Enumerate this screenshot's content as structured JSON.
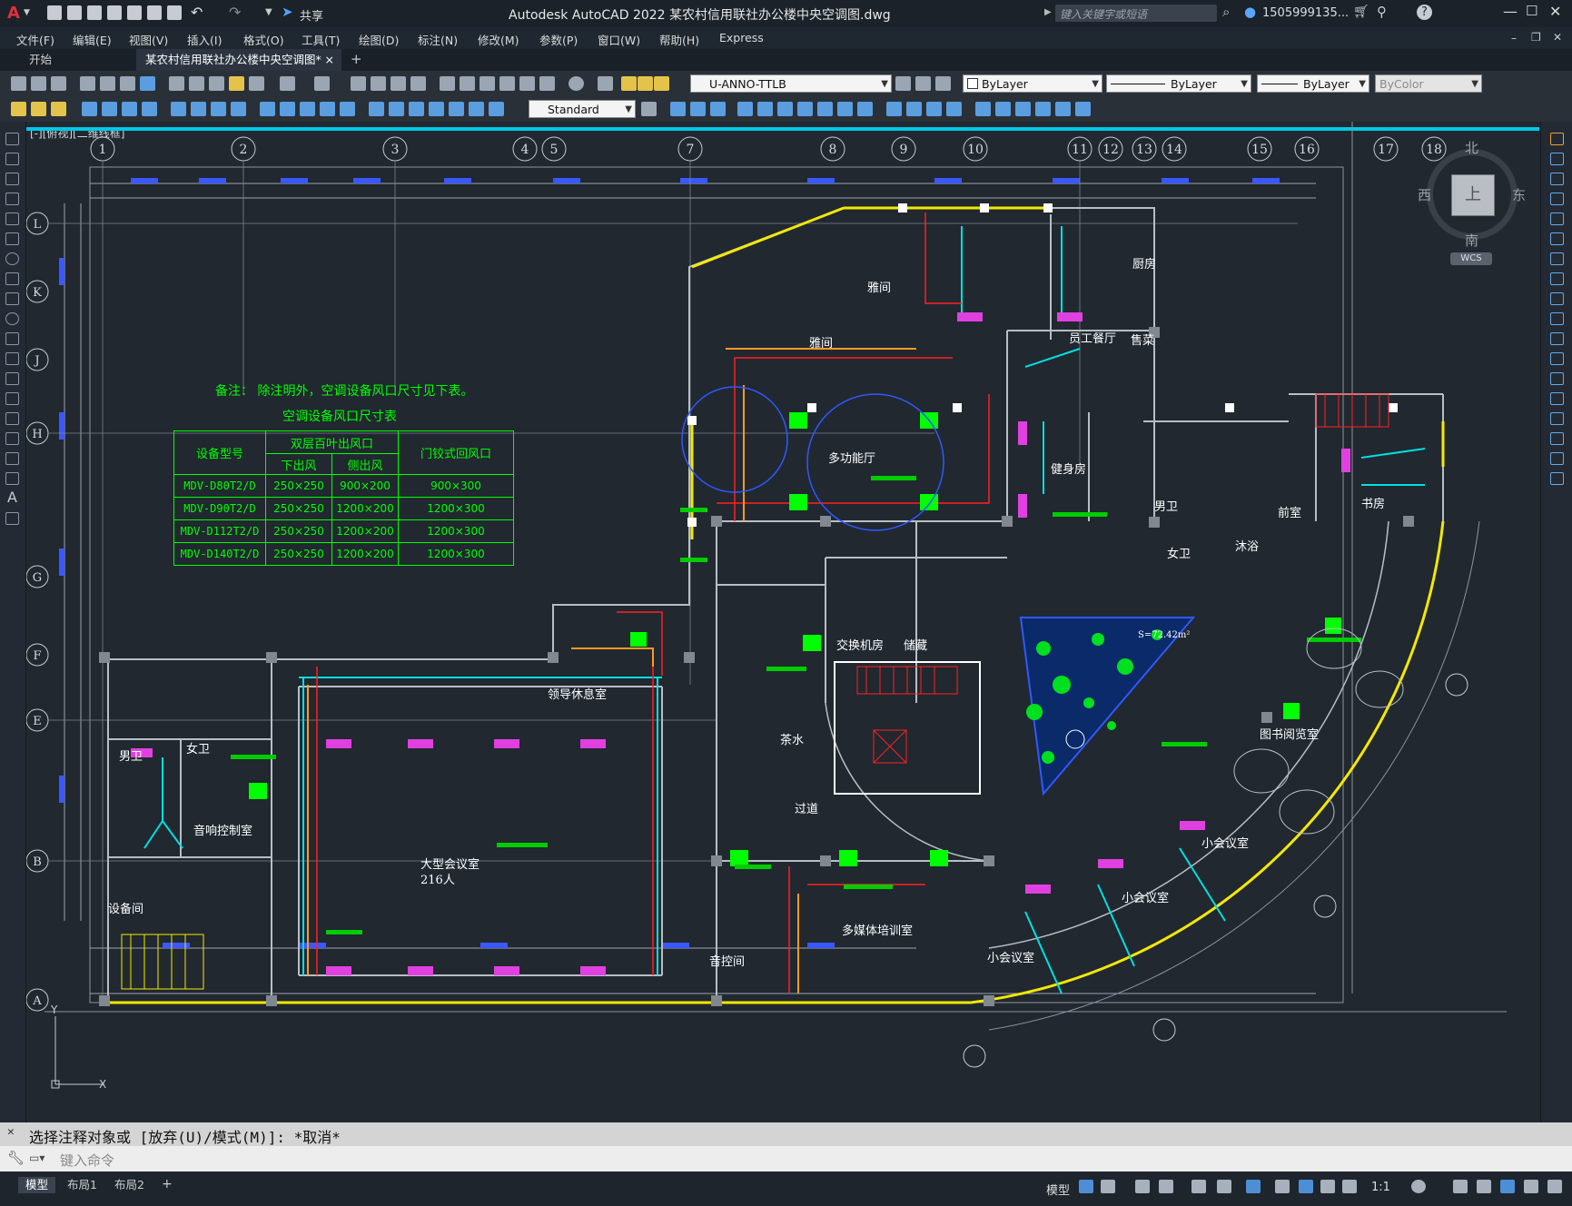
{
  "app": {
    "title": "Autodesk AutoCAD 2022    某农村信用联社办公楼中央空调图.dwg",
    "share_label": "共享",
    "search_placeholder": "键入关键字或短语",
    "user": "1505999135...",
    "logo_letter": "A"
  },
  "menu": [
    "文件(F)",
    "编辑(E)",
    "视图(V)",
    "插入(I)",
    "格式(O)",
    "工具(T)",
    "绘图(D)",
    "标注(N)",
    "修改(M)",
    "参数(P)",
    "窗口(W)",
    "帮助(H)",
    "Express"
  ],
  "tabs": {
    "start": "开始",
    "doc": "某农村信用联社办公楼中央空调图*",
    "close": "×",
    "add": "+"
  },
  "toolbar": {
    "layer_value": "U-ANNO-TTLB",
    "color_value": "ByLayer",
    "linetype_value": "ByLayer",
    "lineweight_value": "ByLayer",
    "plotstyle_value": "ByColor",
    "style_value": "Standard"
  },
  "viewport": {
    "label": "[-][俯视][二维线框]"
  },
  "viewcube": {
    "north": "北",
    "south": "南",
    "east": "东",
    "west": "西",
    "top": "上",
    "wcs": "WCS"
  },
  "drawing": {
    "note": "备注：  除注明外，空调设备风口尺寸见下表。",
    "table_title": "空调设备风口尺寸表",
    "table": {
      "h_model": "设备型号",
      "h_double": "双层百叶出风口",
      "h_down": "下出风",
      "h_side": "侧出风",
      "h_return": "门铰式回风口",
      "rows": [
        [
          "MDV-D80T2/D",
          "250×250",
          "900×200",
          "900×300"
        ],
        [
          "MDV-D90T2/D",
          "250×250",
          "1200×200",
          "1200×300"
        ],
        [
          "MDV-D112T2/D",
          "250×250",
          "1200×200",
          "1200×300"
        ],
        [
          "MDV-D140T2/D",
          "250×250",
          "1200×200",
          "1200×300"
        ]
      ]
    },
    "grid_top": [
      "1",
      "2",
      "3",
      "4",
      "5",
      "7",
      "8",
      "9",
      "10",
      "11",
      "12",
      "13",
      "14",
      "15",
      "16",
      "17",
      "18"
    ],
    "grid_left": [
      "L",
      "K",
      "J",
      "H",
      "G",
      "F",
      "E",
      "B",
      "A"
    ],
    "rooms": {
      "yajian1": "雅间",
      "yajian2": "雅间",
      "chufang": "厨房",
      "yuangong": "员工餐厅",
      "shoucai": "售菜",
      "duogongneng": "多功能厅",
      "jianshen": "健身房",
      "nanwei1": "男卫",
      "nvwei1": "女卫",
      "muyu": "沐浴",
      "qianshi": "前室",
      "shufang": "书房",
      "jiaohuan": "交换机房",
      "chucang": "储藏",
      "chashui": "茶水",
      "lingdao": "领导休息室",
      "nanwei2": "男卫",
      "nvwei2": "女卫",
      "yinxiang": "音响控制室",
      "shebei": "设备间",
      "dahuiyi": "大型会议室 216人",
      "guodao": "过道",
      "tushu": "图书阅览室",
      "xiaohui1": "小会议室",
      "xiaohui2": "小会议室",
      "xiaohui3": "小会议室",
      "duomeiti": "多媒体培训室",
      "yinkong": "音控间",
      "area": "S=72.42m²"
    }
  },
  "command": {
    "history": "选择注释对象或 [放弃(U)/模式(M)]: *取消*",
    "placeholder": "键入命令"
  },
  "layouts": [
    "模型",
    "布局1",
    "布局2"
  ],
  "status": {
    "model": "模型",
    "scale": "1:1"
  },
  "colors": {
    "accent": "#00c0e0",
    "green_text": "#00ff00",
    "wall_yellow": "#f5e800",
    "duct_cyan": "#00e0e0",
    "pipe_red": "#ff2020"
  }
}
